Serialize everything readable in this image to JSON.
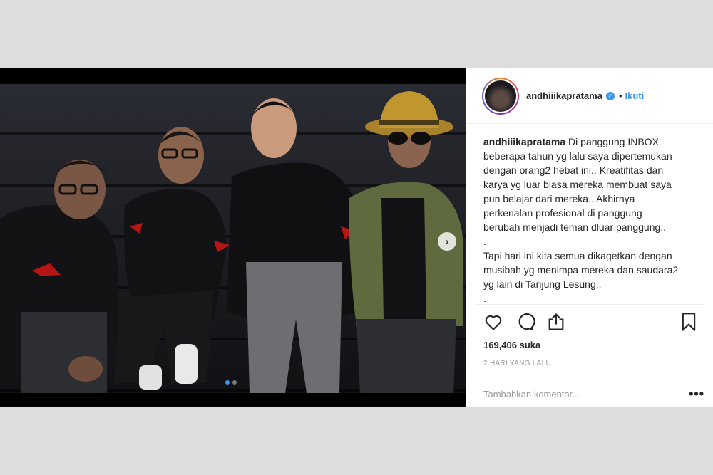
{
  "header": {
    "username": "andhiiikapratama",
    "separator": "•",
    "follow_label": "Ikuti"
  },
  "caption": {
    "username": "andhiiikapratama",
    "lines": [
      " Di panggung INBOX",
      "beberapa tahun yg lalu saya dipertemukan",
      "dengan orang2 hebat ini.. Kreatifitas dan",
      "karya yg luar biasa mereka membuat saya",
      "pun belajar dari mereka.. Akhirnya",
      "perkenalan profesional di panggung",
      "berubah menjadi teman dluar panggung..",
      ".",
      "Tapi hari ini kita semua dikagetkan dengan",
      "musibah yg menimpa mereka dan saudara2",
      "yg lain di Tanjung Lesung..",
      "."
    ]
  },
  "stats": {
    "likes": "169,406 suka",
    "time": "2 HARI YANG LALU"
  },
  "comment": {
    "placeholder": "Tambahkan komentar...",
    "more": "•••"
  },
  "media": {
    "next_arrow": "›",
    "carousel_count": 2,
    "carousel_active": 0
  },
  "colors": {
    "accent": "#3897f0",
    "text": "#262626",
    "muted": "#999999",
    "page_bg": "#dddddd"
  },
  "icons": [
    "heart-icon",
    "comment-icon",
    "share-icon",
    "bookmark-icon",
    "verified-badge-icon",
    "chevron-right-icon"
  ]
}
